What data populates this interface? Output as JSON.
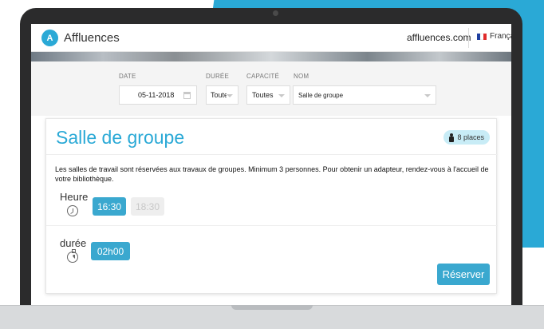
{
  "header": {
    "logo_letter": "A",
    "brand": "Affluences",
    "site": "affluences.com",
    "language": "Français",
    "flag_colors": [
      "#1f3fa0",
      "#ffffff",
      "#e02b2b"
    ]
  },
  "filters": {
    "date_label": "DATE",
    "date_value": "05-11-2018",
    "duration_label": "DURÉE",
    "duration_value": "Toutes",
    "capacity_label": "CAPACITÉ",
    "capacity_value": "Toutes",
    "name_label": "NOM",
    "name_value": "Salle de groupe"
  },
  "room": {
    "title": "Salle de groupe",
    "places": "8 places",
    "description": "Les salles de travail sont réservées aux travaux de groupes. Minimum 3 personnes. Pour obtenir un adapteur, rendez-vous à l'accueil de votre bibliothèque.",
    "time_label": "Heure",
    "times": [
      {
        "label": "16:30",
        "available": true
      },
      {
        "label": "18:30",
        "available": false
      }
    ],
    "duration_label": "durée",
    "durations": [
      {
        "label": "02h00",
        "available": true
      }
    ],
    "reserve_label": "Réserver"
  },
  "colors": {
    "accent": "#2aa9d6",
    "button": "#3aa8cf",
    "frame": "#2b2b2c"
  },
  "icons": [
    "affluences-logo-icon",
    "flag-fr-icon",
    "calendar-icon",
    "chevron-down-icon",
    "person-icon",
    "clock-icon",
    "timer-icon"
  ]
}
